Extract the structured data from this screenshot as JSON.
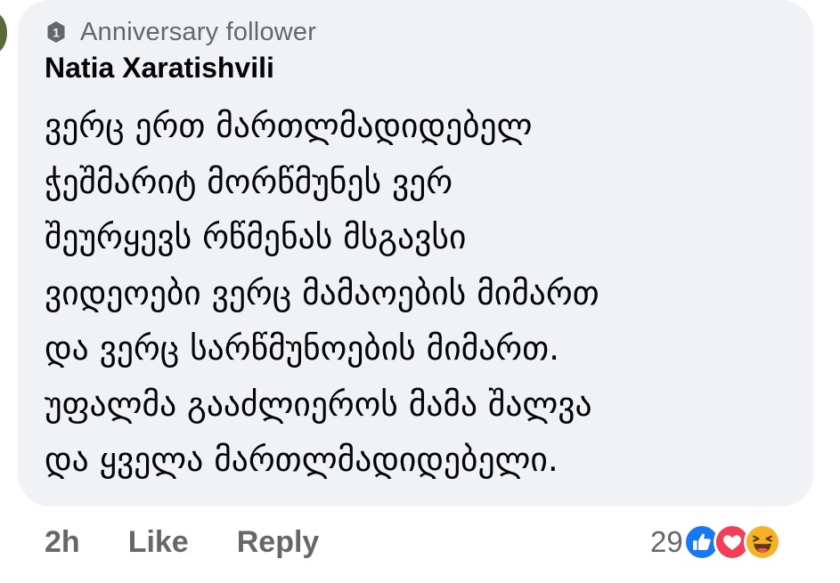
{
  "comment": {
    "badge": {
      "icon": "anniversary-badge-icon",
      "label": "Anniversary follower"
    },
    "author": "Natia Xaratishvili",
    "text_lines": [
      "ვერც ერთ მართლმადიდებელ",
      "ჭეშმარიტ მორწმუნეს ვერ",
      "შეურყევს რწმენას მსგავსი",
      "ვიდეოები ვერც მამაოების მიმართ",
      "და ვერც სარწმუნოების მიმართ.",
      "უფალმა გააძლიეროს მამა შალვა",
      "და ყველა მართლმადიდებელი."
    ],
    "timestamp": "2h",
    "like_label": "Like",
    "reply_label": "Reply",
    "reactions": {
      "count": "29",
      "icons": [
        "like-reaction-icon",
        "love-reaction-icon",
        "haha-reaction-icon"
      ]
    }
  },
  "colors": {
    "bubble_background": "#f0f2f5",
    "secondary_text": "#65676b",
    "primary_text": "#050505",
    "like_blue": "#1877f2",
    "love_red": "#f33e58",
    "haha_yellow": "#f7b125"
  }
}
